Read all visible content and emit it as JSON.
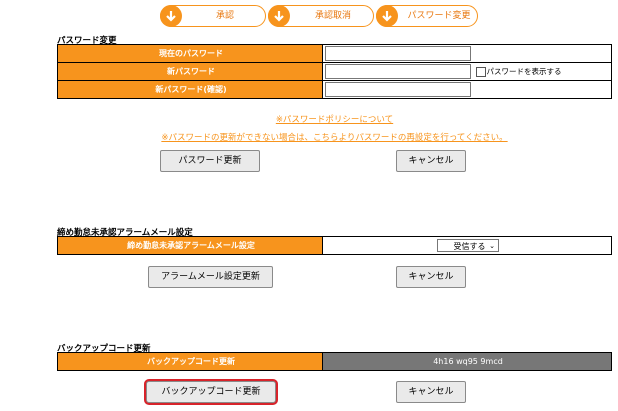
{
  "steps": [
    {
      "label": "承認"
    },
    {
      "label": "承認取消"
    },
    {
      "label": "パスワード変更"
    }
  ],
  "password": {
    "title": "パスワード変更",
    "rows": [
      {
        "label": "現在のパスワード",
        "value": ""
      },
      {
        "label": "新パスワード",
        "value": ""
      },
      {
        "label": "新パスワード(確認)",
        "value": ""
      }
    ],
    "show_password_label": "パスワードを表示する",
    "policy_link": "※パスワードポリシーについて",
    "reset_link": "※パスワードの更新ができない場合は、こちらよりパスワードの再設定を行ってください。",
    "update_button": "パスワード更新",
    "cancel_button": "キャンセル"
  },
  "alarm": {
    "title": "締め勤怠未承認アラームメール設定",
    "row_label": "締め勤怠未承認アラームメール設定",
    "select_value": "受信する",
    "update_button": "アラームメール設定更新",
    "cancel_button": "キャンセル"
  },
  "backup": {
    "title": "バックアップコード更新",
    "row_label": "バックアップコード更新",
    "code": "4h16 wq95 9mcd",
    "update_button": "バックアップコード更新",
    "cancel_button": "キャンセル"
  },
  "colors": {
    "accent": "#f7941d",
    "highlight": "#d8232a",
    "code_bg": "#777777"
  },
  "icons": {
    "step": "arrow-down-circle-icon",
    "select": "chevron-down-icon",
    "checkbox": "checkbox-icon"
  }
}
